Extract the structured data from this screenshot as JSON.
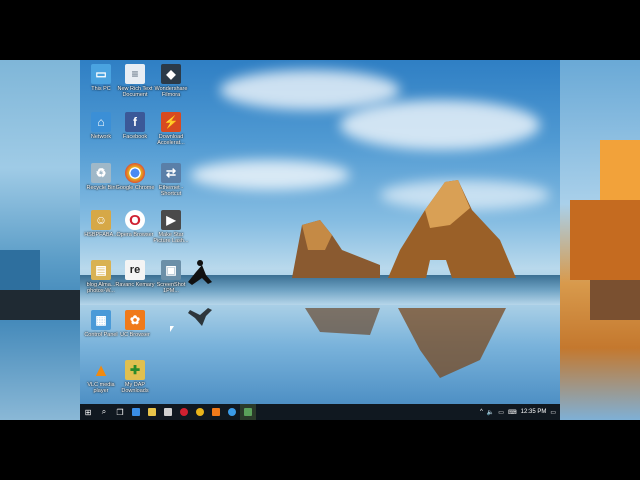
{
  "desktop": {
    "icons": [
      {
        "label": "This PC",
        "icon": "computer-icon",
        "color": "#4aa3e0"
      },
      {
        "label": "New Rich Text Document",
        "icon": "document-icon",
        "color": "#e8eef4"
      },
      {
        "label": "Wondershare Filmora",
        "icon": "filmora-icon",
        "color": "#2b3a48"
      },
      {
        "label": "Network",
        "icon": "network-icon",
        "color": "#3b8fd6"
      },
      {
        "label": "Facebook",
        "icon": "facebook-icon",
        "color": "#3b5998"
      },
      {
        "label": "Download Accelerat...",
        "icon": "download-accelerator-icon",
        "color": "#d84a20"
      },
      {
        "label": "Recycle Bin",
        "icon": "recycle-bin-icon",
        "color": "#9fb8c8"
      },
      {
        "label": "Google Chrome",
        "icon": "chrome-icon",
        "color": "#e8b31a"
      },
      {
        "label": "Ethernet - Shortcut",
        "icon": "ethernet-icon",
        "color": "#5a7fa8"
      },
      {
        "label": "HSBPFABA...",
        "icon": "user-folder-icon",
        "color": "#d6a847"
      },
      {
        "label": "Opera Browser",
        "icon": "opera-icon",
        "color": "#d02030"
      },
      {
        "label": "Make Star Picture Lash...",
        "icon": "video-clip-icon",
        "color": "#4a4a4a"
      },
      {
        "label": "blog Alma... photos-W...",
        "icon": "folder-icon",
        "color": "#d9b253"
      },
      {
        "label": "Ravanc Kemary",
        "icon": "re-icon",
        "color": "#f4f4f4"
      },
      {
        "label": "ScreenShot 1PM...",
        "icon": "screenshot-icon",
        "color": "#6b8fa8"
      },
      {
        "label": "Control Panel",
        "icon": "control-panel-icon",
        "color": "#4a9ad8"
      },
      {
        "label": "UC Browser",
        "icon": "uc-browser-icon",
        "color": "#f07a1a"
      },
      {
        "label": "VLC media player",
        "icon": "vlc-icon",
        "color": "#f08a10"
      },
      {
        "label": "My DAP Downloads",
        "icon": "dap-folder-icon",
        "color": "#e0c050"
      }
    ]
  },
  "taskbar": {
    "start_icon": "⊞",
    "search_icon": "⌕",
    "taskview_icon": "❐",
    "pinned": [
      {
        "name": "edge-icon",
        "color": "#3a8ee6"
      },
      {
        "name": "file-explorer-icon",
        "color": "#e8c44a"
      },
      {
        "name": "store-icon",
        "color": "#d0d0d0"
      },
      {
        "name": "opera-icon",
        "color": "#d02030"
      },
      {
        "name": "chrome-icon",
        "color": "#e8b31a"
      },
      {
        "name": "uc-browser-icon",
        "color": "#f07a1a"
      },
      {
        "name": "ie-icon",
        "color": "#3a9be8"
      },
      {
        "name": "utility-icon",
        "color": "#5aa05a"
      }
    ],
    "tray_up": "^",
    "volume": "🔈",
    "network": "▭",
    "message": "▭",
    "time": "12:35 PM"
  }
}
